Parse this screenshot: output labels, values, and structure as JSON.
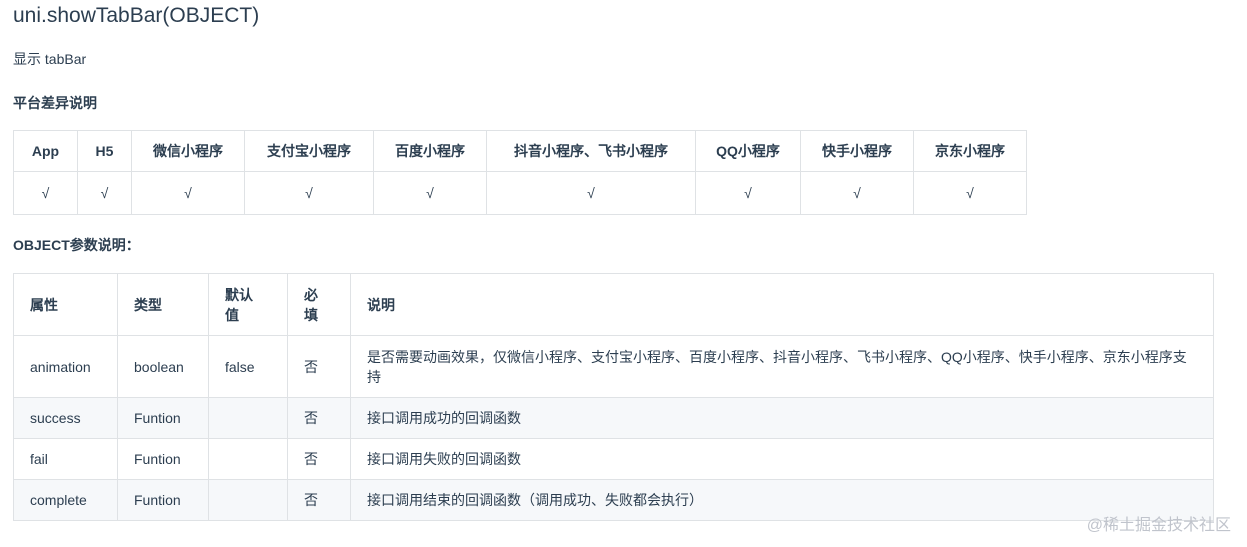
{
  "title": "uni.showTabBar(OBJECT)",
  "description": "显示 tabBar",
  "platform_heading": "平台差异说明",
  "platform_table": {
    "headers": [
      "App",
      "H5",
      "微信小程序",
      "支付宝小程序",
      "百度小程序",
      "抖音小程序、飞书小程序",
      "QQ小程序",
      "快手小程序",
      "京东小程序"
    ],
    "values": [
      "√",
      "√",
      "√",
      "√",
      "√",
      "√",
      "√",
      "√",
      "√"
    ]
  },
  "object_heading": "OBJECT参数说明：",
  "params_table": {
    "headers": [
      "属性",
      "类型",
      "默认值",
      "必填",
      "说明"
    ],
    "rows": [
      [
        "animation",
        "boolean",
        "false",
        "否",
        "是否需要动画效果，仅微信小程序、支付宝小程序、百度小程序、抖音小程序、飞书小程序、QQ小程序、快手小程序、京东小程序支持"
      ],
      [
        "success",
        "Funtion",
        "",
        "否",
        "接口调用成功的回调函数"
      ],
      [
        "fail",
        "Funtion",
        "",
        "否",
        "接口调用失败的回调函数"
      ],
      [
        "complete",
        "Funtion",
        "",
        "否",
        "接口调用结束的回调函数（调用成功、失败都会执行）"
      ]
    ]
  },
  "watermark": "@稀土掘金技术社区"
}
